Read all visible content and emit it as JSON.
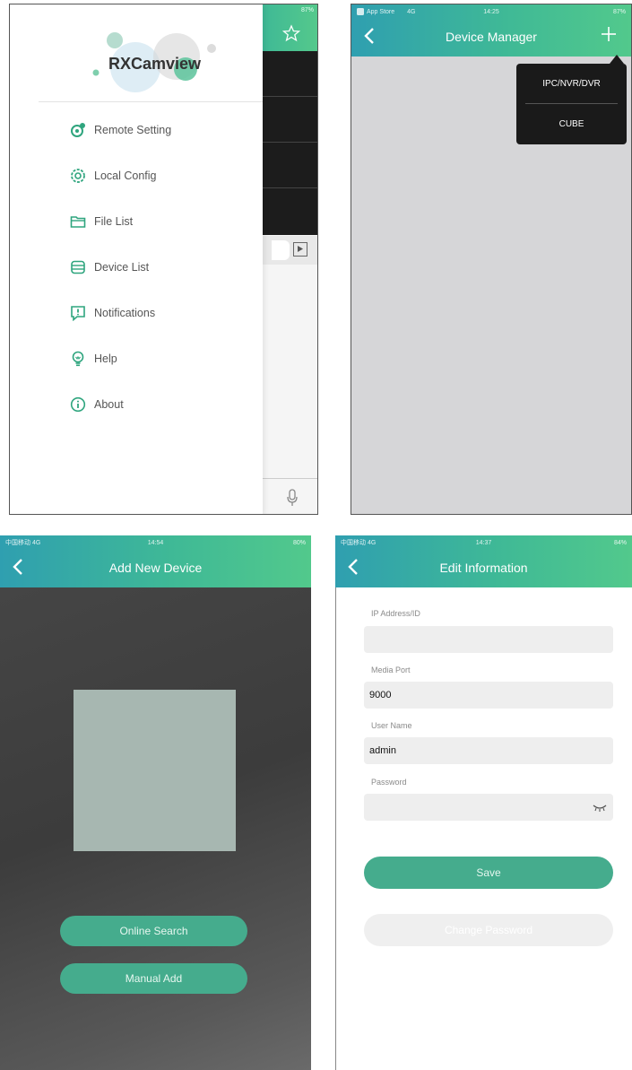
{
  "drawer": {
    "app_name": "RXCamview",
    "status_right": "87%",
    "menu": [
      {
        "label": "Remote Setting",
        "icon": "gear-icon"
      },
      {
        "label": "Local Config",
        "icon": "settings-icon"
      },
      {
        "label": "File List",
        "icon": "folder-icon"
      },
      {
        "label": "Device List",
        "icon": "device-icon"
      },
      {
        "label": "Notifications",
        "icon": "alert-icon"
      },
      {
        "label": "Help",
        "icon": "bulb-icon"
      },
      {
        "label": "About",
        "icon": "info-icon"
      }
    ]
  },
  "device_manager": {
    "status_left": "App Store",
    "status_net": "4G",
    "status_time": "14:25",
    "status_right": "87%",
    "title": "Device Manager",
    "add_icon": "plus-icon",
    "popup": [
      "IPC/NVR/DVR",
      "CUBE"
    ]
  },
  "add_device": {
    "status_left": "中国移动 4G",
    "status_time": "14:54",
    "status_right": "80%",
    "title": "Add New Device",
    "buttons": [
      "Online Search",
      "Manual Add"
    ]
  },
  "edit_info": {
    "status_left": "中国移动 4G",
    "status_time": "14:37",
    "status_right": "84%",
    "title": "Edit Information",
    "fields": [
      {
        "label": "IP Address/ID",
        "value": ""
      },
      {
        "label": "Media Port",
        "value": "9000"
      },
      {
        "label": "User Name",
        "value": "admin"
      },
      {
        "label": "Password",
        "value": ""
      }
    ],
    "save_label": "Save",
    "change_password_label": "Change Password"
  },
  "colors": {
    "accent": "#45ac8d",
    "header_start": "#2f9fb0",
    "header_end": "#52c98c"
  }
}
